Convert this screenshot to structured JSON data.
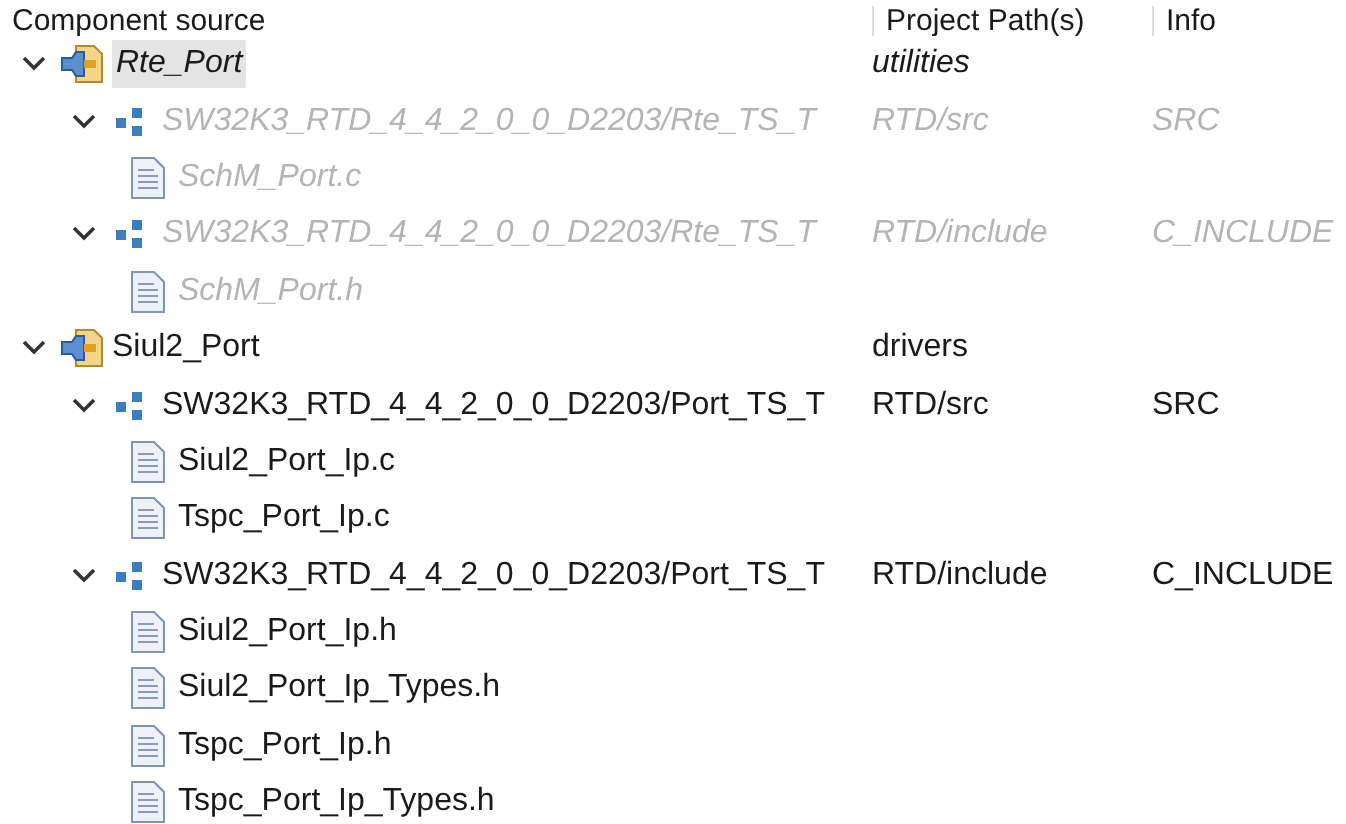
{
  "columns": [
    "Component source",
    "Project Path(s)",
    "Info"
  ],
  "tree": [
    {
      "kind": "component",
      "label": "Rte_Port",
      "path": "utilities",
      "expanded": true,
      "selected": true,
      "disabled": false,
      "children": [
        {
          "kind": "folder",
          "label": "SW32K3_RTD_4_4_2_0_0_D2203/Rte_TS_T",
          "path": "RTD/src",
          "info": "SRC",
          "expanded": true,
          "disabled": true,
          "children": [
            {
              "kind": "file",
              "label": "SchM_Port.c",
              "disabled": true
            }
          ]
        },
        {
          "kind": "folder",
          "label": "SW32K3_RTD_4_4_2_0_0_D2203/Rte_TS_T",
          "path": "RTD/include",
          "info": "C_INCLUDE",
          "expanded": true,
          "disabled": true,
          "children": [
            {
              "kind": "file",
              "label": "SchM_Port.h",
              "disabled": true
            }
          ]
        }
      ]
    },
    {
      "kind": "component",
      "label": "Siul2_Port",
      "path": "drivers",
      "expanded": true,
      "selected": false,
      "disabled": false,
      "children": [
        {
          "kind": "folder",
          "label": "SW32K3_RTD_4_4_2_0_0_D2203/Port_TS_T",
          "path": "RTD/src",
          "info": "SRC",
          "expanded": true,
          "disabled": false,
          "children": [
            {
              "kind": "file",
              "label": "Siul2_Port_Ip.c",
              "disabled": false
            },
            {
              "kind": "file",
              "label": "Tspc_Port_Ip.c",
              "disabled": false
            }
          ]
        },
        {
          "kind": "folder",
          "label": "SW32K3_RTD_4_4_2_0_0_D2203/Port_TS_T",
          "path": "RTD/include",
          "info": "C_INCLUDE",
          "expanded": true,
          "disabled": false,
          "children": [
            {
              "kind": "file",
              "label": "Siul2_Port_Ip.h",
              "disabled": false
            },
            {
              "kind": "file",
              "label": "Siul2_Port_Ip_Types.h",
              "disabled": false
            },
            {
              "kind": "file",
              "label": "Tspc_Port_Ip.h",
              "disabled": false
            },
            {
              "kind": "file",
              "label": "Tspc_Port_Ip_Types.h",
              "disabled": false
            }
          ]
        }
      ]
    }
  ]
}
